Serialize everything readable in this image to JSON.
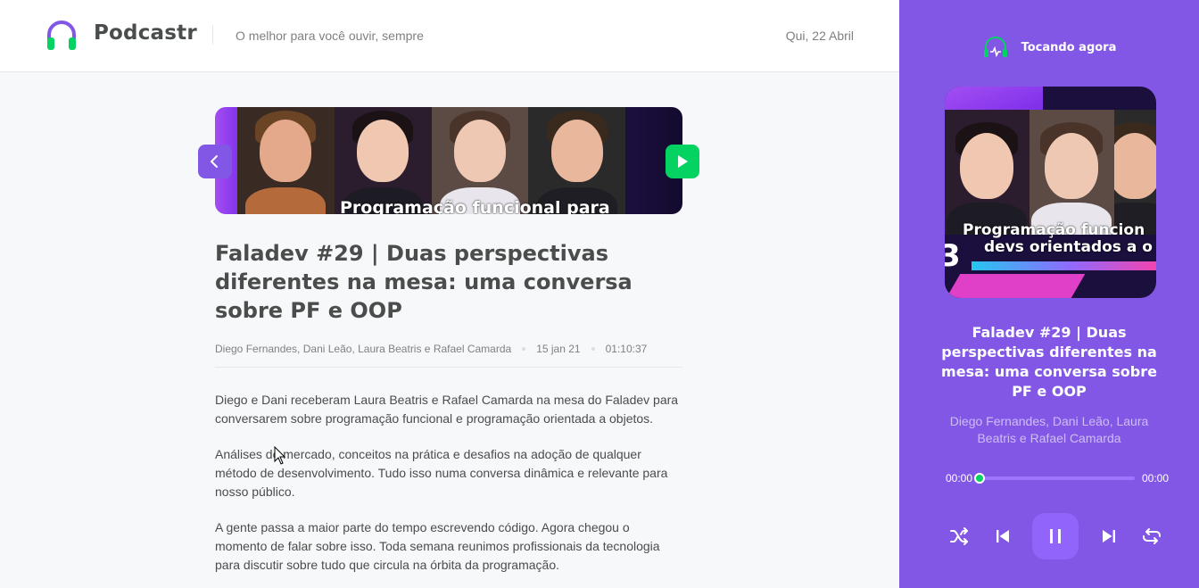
{
  "header": {
    "app_name": "Podcastr",
    "tagline": "O melhor para você ouvir, sempre",
    "date": "Qui, 22 Abril"
  },
  "episode": {
    "thumbnail_caption": "Programação funcional para",
    "title": "Faladev #29 | Duas perspectivas diferentes na mesa: uma conversa sobre PF e OOP",
    "members": "Diego Fernandes, Dani Leão, Laura Beatris e Rafael Camarda",
    "published_at": "15 jan 21",
    "duration": "01:10:37",
    "description": [
      "Diego e Dani receberam Laura Beatris e Rafael Camarda na mesa do Faladev para conversarem sobre programação funcional e programação orientada a objetos.",
      "Análises de mercado, conceitos na prática e desafios na adoção de qualquer método de desenvolvimento. Tudo isso numa conversa dinâmica e relevante para nosso público.",
      "A gente passa a maior parte do tempo escrevendo código. Agora chegou o momento de falar sobre isso. Toda semana reunimos profissionais da tecnologia para discutir sobre tudo que circula na órbita da programação."
    ]
  },
  "player": {
    "label": "Tocando agora",
    "cover_caption_line1": "Programação funcion",
    "cover_caption_line2": "devs orientados a o",
    "cover_number": "3",
    "title": "Faladev #29 | Duas perspectivas diferentes na mesa: uma conversa sobre PF e OOP",
    "members": "Diego Fernandes, Dani Leão, Laura Beatris e Rafael Camarda",
    "current_time": "00:00",
    "total_time": "00:00",
    "progress": 0
  },
  "colors": {
    "primary": "#8257e5",
    "green": "#04d361",
    "text": "#494d4b"
  },
  "icons": [
    "headphones-logo-icon",
    "arrow-left-icon",
    "play-icon",
    "playing-headphones-icon",
    "shuffle-icon",
    "play-previous-icon",
    "pause-icon",
    "play-next-icon",
    "repeat-icon"
  ]
}
